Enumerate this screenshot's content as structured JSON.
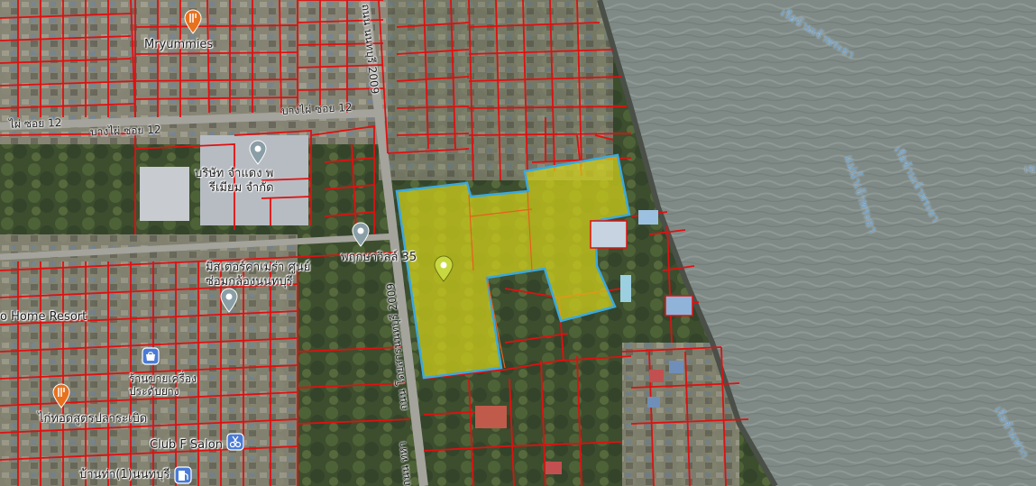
{
  "map": {
    "labels": {
      "mryummies": "Mryummies",
      "company": [
        "บริษัท จำแดง พ",
        "รีเมียม จำกัด"
      ],
      "pruksa": "พฤกษาวิลล์ 35",
      "mister": [
        "มิสเตอร์คาเมร่า ศูนย์",
        "ซ่อมกล้องนนทบุรี"
      ],
      "home_resort": "o Home Resort",
      "shop": [
        "ร้านขายเครื่อง",
        "ประดับยาง"
      ],
      "tod": "ไก่ทอดสูตรปลาระเบิด",
      "club": "Club F Salon",
      "banta": "บ้านท่า(1)นนทบุรี"
    },
    "roads": {
      "soi12_a": "บางไผ่ ซอย 12",
      "soi12_b": "บางไผ่ ซอย 12",
      "soi12_c": "ไผ่ ซอย 12",
      "nonthaburi_top": "ถนน นนทบุรี 2009",
      "nonthaburi_mid": "ถนน โดยสารนนทบุรี 2009",
      "nonthaburi_bot": "ถนน ทหา"
    },
    "water": {
      "river": "แม่น้ำเจ้าพระยา",
      "pier_1": "เรือข้ามเจ้าพระยา",
      "pier_2": "เรือข้ามเจ้าพระยา",
      "pier_3": "เรือข้ามฟาก",
      "edge": "เข"
    },
    "colors": {
      "parcel_outline": "#e01010",
      "highlight_fill": "#d4d21a",
      "highlight_stroke": "#3aa9e0",
      "river": "#7f8a86",
      "pin": "#c8d840"
    }
  }
}
